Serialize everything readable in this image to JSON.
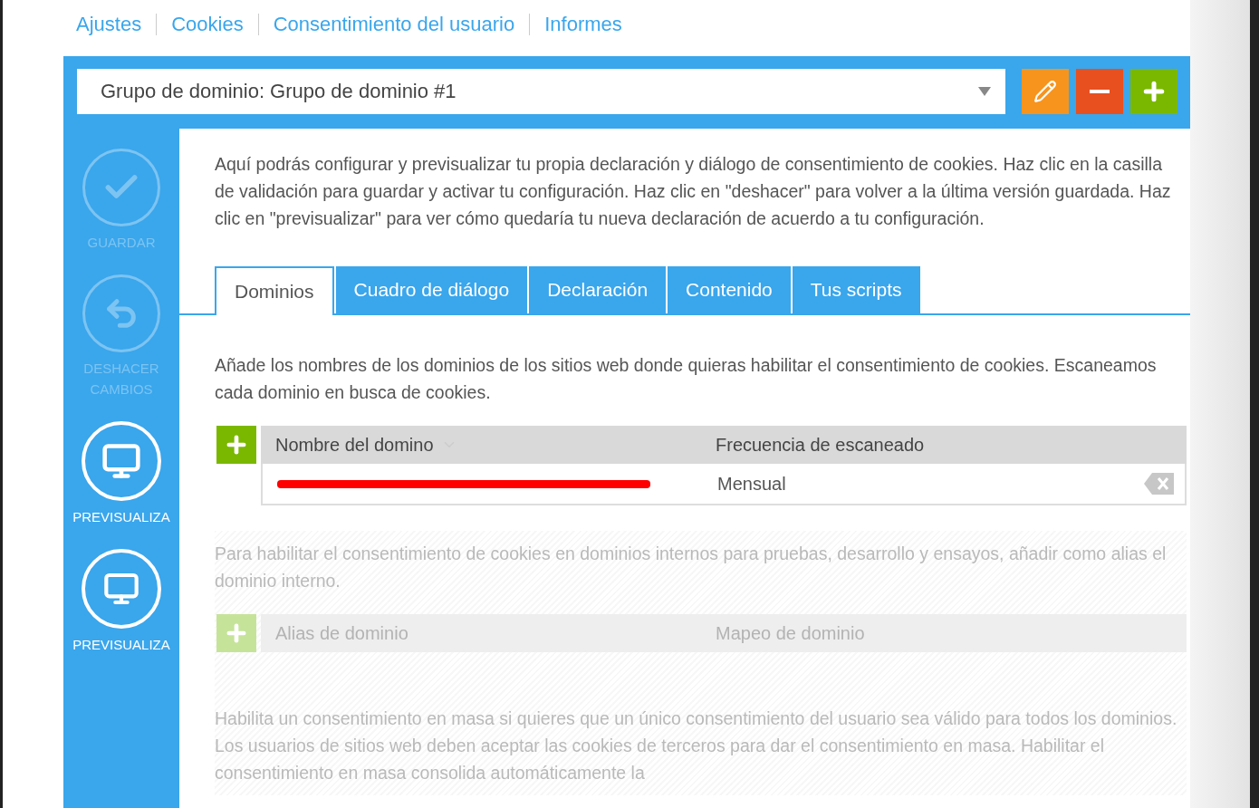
{
  "nav": [
    {
      "label": "Ajustes"
    },
    {
      "label": "Cookies"
    },
    {
      "label": "Consentimiento del usuario"
    },
    {
      "label": "Informes"
    }
  ],
  "group_select": {
    "value": "Grupo de dominio: Grupo de dominio #1"
  },
  "toolbar_buttons": [
    {
      "kind": "edit"
    },
    {
      "kind": "remove"
    },
    {
      "kind": "add"
    }
  ],
  "sidebar_actions": [
    {
      "kind": "save",
      "label": "GUARDAR",
      "disabled": true
    },
    {
      "kind": "undo",
      "label": "DESHACER CAMBIOS",
      "disabled": true
    },
    {
      "kind": "preview",
      "label": "PREVISUALIZA",
      "disabled": false
    },
    {
      "kind": "preview-alt",
      "label": "PREVISUALIZA",
      "disabled": false
    }
  ],
  "intro": "Aquí podrás configurar y previsualizar tu propia declaración y diálogo de consentimiento de cookies. Haz clic en la casilla de validación para guardar y activar tu configuración. Haz clic en \"deshacer\" para volver a la última versión guardada. Haz clic en \"previsualizar\" para ver cómo quedaría tu nueva declaración de acuerdo a tu configuración.",
  "tabs": [
    {
      "label": "Dominios",
      "selected": true
    },
    {
      "label": "Cuadro de diálogo",
      "selected": false
    },
    {
      "label": "Declaración",
      "selected": false
    },
    {
      "label": "Contenido",
      "selected": false
    },
    {
      "label": "Tus scripts",
      "selected": false
    }
  ],
  "domains": {
    "description": "Añade los nombres de los dominios de los sitios web donde quieras habilitar el consentimiento de cookies. Escaneamos cada dominio en busca de cookies.",
    "columns": [
      "Nombre del domino",
      "Frecuencia de escaneado"
    ],
    "rows": [
      {
        "domain_redacted": true,
        "frequency": "Mensual"
      }
    ]
  },
  "aliases": {
    "disabled": true,
    "description": "Para habilitar el consentimiento de cookies en dominios internos para pruebas, desarrollo y ensayos, añadir como alias el dominio interno.",
    "columns": [
      "Alias de dominio",
      "Mapeo de dominio"
    ]
  },
  "bulk_consent": {
    "disabled": true,
    "description": "Habilita un consentimiento en masa si quieres que un único consentimiento del usuario sea válido para todos los dominios. Los usuarios de sitios web deben aceptar las cookies de terceros para dar el consentimiento en masa. Habilitar el consentimiento en masa consolida automáticamente la"
  }
}
